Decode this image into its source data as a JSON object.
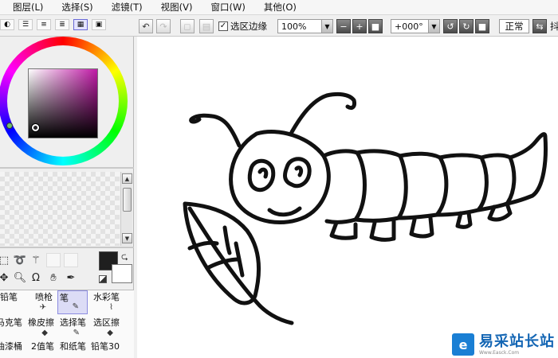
{
  "menu": [
    {
      "label": "图层(L)"
    },
    {
      "label": "选择(S)"
    },
    {
      "label": "滤镜(T)"
    },
    {
      "label": "视图(V)"
    },
    {
      "label": "窗口(W)"
    },
    {
      "label": "其他(O)"
    }
  ],
  "toolbar": {
    "selection_edge_label": "选区边缘",
    "selection_edge_checked": true,
    "zoom_value": "100%",
    "rotation_value": "+000°",
    "blend_mode": "正常",
    "partial_label": "抖"
  },
  "left_panel": {
    "color_modes": [
      "color-wheel",
      "rgb-sliders",
      "hsv-sliders",
      "color-sets",
      "color-grid",
      "scratchpad"
    ],
    "active_color_mode_index": 4,
    "hue_color": "#c01aa6",
    "foreground_color": "#1f1f1f",
    "background_color": "#ffffff",
    "brushes": [
      {
        "label": "铅笔"
      },
      {
        "label": "喷枪"
      },
      {
        "label": "笔"
      },
      {
        "label": "水彩笔"
      },
      {
        "label": "马克笔"
      },
      {
        "label": "橡皮擦"
      },
      {
        "label": "选择笔"
      },
      {
        "label": "选区擦"
      },
      {
        "label": "油漆桶"
      },
      {
        "label": "2值笔"
      },
      {
        "label": "和纸笔"
      },
      {
        "label": "铅笔30"
      }
    ],
    "selected_brush_index": 2
  },
  "watermark": {
    "title": "易采站长站",
    "subtitle": "Www.Easck.Com"
  }
}
